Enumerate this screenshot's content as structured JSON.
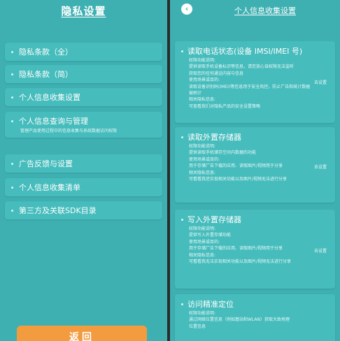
{
  "left": {
    "title": "隐私设置",
    "menu": [
      {
        "label": "隐私条款（全）"
      },
      {
        "label": "隐私条款（简）"
      },
      {
        "label": "个人信息收集设置"
      },
      {
        "label": "个人信息查询与管理",
        "desc": "管理产品使用过程中的信息收集与系统数据访问权限"
      },
      {
        "label": "广告反馈与设置"
      },
      {
        "label": "个人信息收集清单"
      },
      {
        "label": "第三方及关联SDK目录"
      }
    ],
    "back_label": "返回"
  },
  "right": {
    "title": "个人信息收集设置",
    "cards": [
      {
        "title": "读取电话状态(设备 IMSI/IMEI 号)",
        "lines": [
          "权限功能说明:",
          "提供读取手机设备标识等信息，请您放心该权限无法监听",
          "获取您的任何通话内容与信息",
          "使用场景或目的:",
          "读取设备识别码(IMEI)等信息用于安全风控，防止广告和统计数据",
          "被刷计",
          "相关隐私信息:",
          "可查看我们对隐私产品的安全设置策略"
        ],
        "link": "去设置"
      },
      {
        "title": "读取外置存储器",
        "lines": [
          "权限功能说明:",
          "提供读取手机储存空间内数据的功能",
          "使用场景或目的:",
          "用于存储广告下载的应用、读取图片/视频用于分享",
          "相关隐私信息:",
          "可看看我还实现相关功能以及图片/视频无法进行分享"
        ],
        "link": "去设置"
      },
      {
        "title": "写入外置存储器",
        "lines": [
          "权限功能说明:",
          "提供写入外置存储功能",
          "使用场景或目的:",
          "用于存储广告下载的应用、读取图片/视频用于分享",
          "相关隐私信息:",
          "可看看我无法实现相关功能以及图片/视频无法进行分享"
        ],
        "link": "去设置"
      },
      {
        "title": "访问精准定位",
        "lines": [
          "权限功能说明:",
          "通过网络位置信息（例如基站和WLAN）获取大致地理",
          "位置信息"
        ],
        "link": ""
      }
    ]
  }
}
